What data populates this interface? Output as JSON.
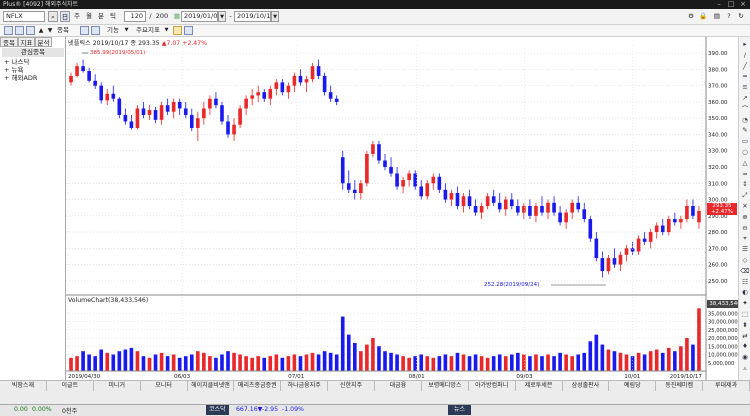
{
  "window": {
    "title": "Plus® [4092] 해외주식차트"
  },
  "toolbar": {
    "symbol": "NFLX",
    "period_buttons": [
      "주",
      "월",
      "분",
      "틱"
    ],
    "count_current": "120",
    "count_max": "200",
    "date_from": "2019/01/03",
    "date_to": "2019/10/17"
  },
  "toolbar2": {
    "labels": [
      "종목",
      "기능",
      "주요지표"
    ]
  },
  "left_panel": {
    "tabs": [
      "종목",
      "지표",
      "분석"
    ],
    "group_title": "관심종목",
    "items": [
      "나스닥",
      "뉴욕",
      "해외ADR"
    ]
  },
  "price_header": {
    "name": "넷플릭스",
    "date": "2019/10/17",
    "label": "종",
    "close": "293.35",
    "change": "▲7.07",
    "pct": "+2.47%"
  },
  "annotations": {
    "high": "385.99(2019/05/01)",
    "low": "252.28(2019/09/24)"
  },
  "volume_header": {
    "label": "VolumeChart(38,433,546)"
  },
  "price_tag": {
    "value": "293.35",
    "sub": "+2.47%"
  },
  "volume_tag": {
    "value": "38,433,546"
  },
  "colors": {
    "up": "#e8282a",
    "down": "#1a1aee"
  },
  "chart_data": {
    "type": "candlestick",
    "price_axis_ticks": [
      "390.00",
      "380.00",
      "370.00",
      "360.00",
      "350.00",
      "340.00",
      "330.00",
      "320.00",
      "310.00",
      "300.00",
      "290.00",
      "280.00",
      "270.00",
      "260.00",
      "250.00"
    ],
    "volume_axis_ticks": [
      "35,000,000",
      "30,000,000",
      "25,000,000",
      "20,000,000",
      "15,000,000",
      "10,000,000",
      "5,000,000"
    ],
    "x_labels": [
      "2019/04/30",
      "06/03",
      "07/01",
      "08/01",
      "09/03",
      "10/01",
      "2019/10/17"
    ],
    "ylim": [
      245,
      395
    ],
    "vol_max": 40000000,
    "candles": [
      [
        372,
        378,
        370,
        376,
        8
      ],
      [
        376,
        384,
        375,
        382,
        9
      ],
      [
        382,
        386,
        378,
        379,
        12
      ],
      [
        379,
        381,
        372,
        373,
        10
      ],
      [
        373,
        377,
        368,
        370,
        9
      ],
      [
        370,
        372,
        359,
        361,
        13
      ],
      [
        361,
        368,
        358,
        365,
        11
      ],
      [
        365,
        370,
        360,
        362,
        10
      ],
      [
        362,
        363,
        350,
        352,
        12
      ],
      [
        352,
        356,
        346,
        348,
        13
      ],
      [
        348,
        352,
        343,
        344,
        14
      ],
      [
        344,
        358,
        343,
        356,
        12
      ],
      [
        356,
        360,
        350,
        352,
        9
      ],
      [
        352,
        358,
        349,
        355,
        8
      ],
      [
        355,
        357,
        347,
        349,
        10
      ],
      [
        349,
        360,
        346,
        358,
        11
      ],
      [
        358,
        362,
        352,
        354,
        9
      ],
      [
        354,
        362,
        350,
        360,
        10
      ],
      [
        360,
        362,
        352,
        356,
        8
      ],
      [
        356,
        360,
        350,
        352,
        9
      ],
      [
        352,
        356,
        342,
        344,
        10
      ],
      [
        344,
        354,
        336,
        350,
        12
      ],
      [
        350,
        360,
        346,
        356,
        11
      ],
      [
        356,
        364,
        352,
        362,
        9
      ],
      [
        362,
        366,
        356,
        358,
        8
      ],
      [
        358,
        360,
        346,
        348,
        10
      ],
      [
        348,
        352,
        338,
        340,
        12
      ],
      [
        340,
        350,
        336,
        346,
        11
      ],
      [
        346,
        358,
        344,
        356,
        10
      ],
      [
        356,
        364,
        352,
        362,
        9
      ],
      [
        362,
        368,
        358,
        364,
        8
      ],
      [
        364,
        370,
        360,
        366,
        9
      ],
      [
        366,
        368,
        360,
        362,
        8
      ],
      [
        362,
        370,
        358,
        368,
        9
      ],
      [
        368,
        374,
        364,
        372,
        10
      ],
      [
        372,
        374,
        364,
        366,
        8
      ],
      [
        366,
        372,
        362,
        370,
        9
      ],
      [
        370,
        378,
        366,
        376,
        10
      ],
      [
        376,
        380,
        370,
        372,
        9
      ],
      [
        372,
        376,
        366,
        374,
        10
      ],
      [
        374,
        384,
        372,
        382,
        11
      ],
      [
        382,
        386,
        374,
        376,
        10
      ],
      [
        376,
        378,
        364,
        366,
        12
      ],
      [
        366,
        370,
        360,
        362,
        11
      ],
      [
        362,
        364,
        358,
        360,
        10
      ],
      [
        326,
        330,
        306,
        310,
        33
      ],
      [
        310,
        318,
        304,
        306,
        22
      ],
      [
        306,
        312,
        300,
        304,
        17
      ],
      [
        304,
        312,
        300,
        310,
        12
      ],
      [
        310,
        330,
        308,
        328,
        16
      ],
      [
        328,
        336,
        326,
        334,
        20
      ],
      [
        334,
        336,
        322,
        324,
        15
      ],
      [
        324,
        328,
        318,
        320,
        12
      ],
      [
        320,
        326,
        314,
        316,
        11
      ],
      [
        316,
        320,
        306,
        308,
        10
      ],
      [
        308,
        314,
        304,
        312,
        9
      ],
      [
        312,
        318,
        308,
        316,
        8
      ],
      [
        316,
        318,
        306,
        308,
        9
      ],
      [
        308,
        312,
        300,
        302,
        10
      ],
      [
        302,
        312,
        300,
        310,
        9
      ],
      [
        310,
        316,
        306,
        314,
        8
      ],
      [
        314,
        316,
        304,
        306,
        9
      ],
      [
        306,
        310,
        298,
        300,
        10
      ],
      [
        300,
        306,
        296,
        304,
        9
      ],
      [
        304,
        308,
        294,
        296,
        11
      ],
      [
        296,
        304,
        292,
        302,
        10
      ],
      [
        302,
        306,
        294,
        296,
        9
      ],
      [
        296,
        300,
        290,
        292,
        10
      ],
      [
        292,
        298,
        288,
        296,
        9
      ],
      [
        296,
        304,
        294,
        302,
        8
      ],
      [
        302,
        306,
        296,
        298,
        9
      ],
      [
        298,
        304,
        292,
        294,
        10
      ],
      [
        294,
        302,
        290,
        300,
        9
      ],
      [
        300,
        304,
        294,
        296,
        10
      ],
      [
        296,
        300,
        290,
        292,
        11
      ],
      [
        292,
        298,
        288,
        296,
        10
      ],
      [
        296,
        300,
        288,
        290,
        9
      ],
      [
        290,
        298,
        286,
        296,
        10
      ],
      [
        296,
        302,
        290,
        292,
        9
      ],
      [
        292,
        300,
        288,
        298,
        10
      ],
      [
        298,
        302,
        290,
        292,
        9
      ],
      [
        292,
        296,
        284,
        286,
        11
      ],
      [
        286,
        294,
        282,
        292,
        10
      ],
      [
        292,
        300,
        288,
        298,
        9
      ],
      [
        298,
        302,
        292,
        294,
        10
      ],
      [
        294,
        298,
        286,
        288,
        11
      ],
      [
        288,
        290,
        274,
        276,
        18
      ],
      [
        276,
        280,
        262,
        264,
        22
      ],
      [
        264,
        268,
        252,
        256,
        16
      ],
      [
        256,
        266,
        254,
        264,
        13
      ],
      [
        264,
        270,
        258,
        260,
        12
      ],
      [
        260,
        268,
        256,
        266,
        11
      ],
      [
        266,
        272,
        262,
        270,
        10
      ],
      [
        270,
        274,
        266,
        268,
        9
      ],
      [
        268,
        278,
        266,
        276,
        11
      ],
      [
        276,
        280,
        272,
        274,
        10
      ],
      [
        274,
        282,
        270,
        280,
        12
      ],
      [
        280,
        286,
        276,
        284,
        13
      ],
      [
        284,
        288,
        278,
        280,
        11
      ],
      [
        280,
        290,
        278,
        288,
        14
      ],
      [
        288,
        292,
        284,
        286,
        12
      ],
      [
        286,
        290,
        282,
        288,
        15
      ],
      [
        288,
        300,
        286,
        296,
        20
      ],
      [
        296,
        300,
        288,
        290,
        16
      ],
      [
        286,
        296,
        282,
        293,
        38
      ]
    ]
  },
  "bottom_tabs": [
    "빅팜스재",
    "이글트",
    "미니거",
    "모니터",
    "헤이치클비넷앤",
    "메리츠종금증권",
    "하나금융지주",
    "신한지주",
    "대금융",
    "보령메디앙스",
    "아가방컴퍼니",
    "제로투세븐",
    "삼성출판사",
    "예림당",
    "동진쎄미켐",
    "루대제과"
  ],
  "status": {
    "v1": "0.00",
    "v2": "0.00%",
    "v3": "0천주",
    "index_name": "코스닥",
    "index_value": "667.16▼",
    "index_change": "-2.95",
    "index_pct": "-1.09%",
    "news_label": "뉴스"
  }
}
